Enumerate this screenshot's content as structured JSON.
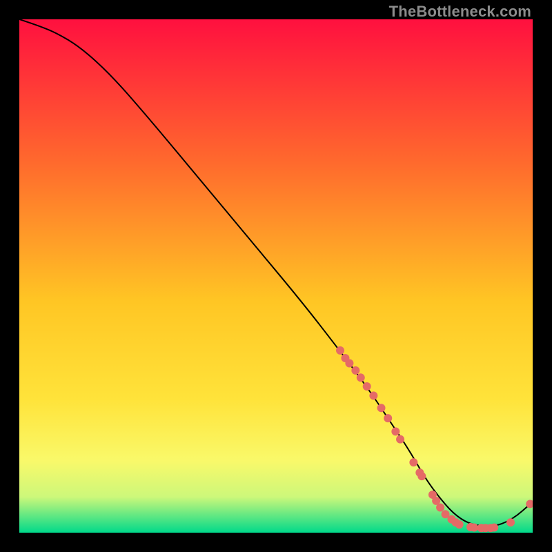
{
  "watermark": "TheBottleneck.com",
  "colors": {
    "gradient_top": "#ff103f",
    "gradient_mid1": "#ff6a2d",
    "gradient_mid2": "#ffc624",
    "gradient_mid3": "#ffe33a",
    "gradient_mid4": "#f9f96a",
    "gradient_mid5": "#cdf87a",
    "gradient_bottom": "#00d98a",
    "curve": "#000000",
    "marker": "#e56a66",
    "bg": "#000000"
  },
  "chart_data": {
    "type": "line",
    "title": "",
    "xlabel": "",
    "ylabel": "",
    "xlim": [
      0,
      100
    ],
    "ylim": [
      0,
      100
    ],
    "curve": {
      "x": [
        0,
        3,
        7,
        12,
        18,
        25,
        35,
        45,
        55,
        62,
        68,
        72,
        76,
        80,
        86,
        92,
        96,
        100
      ],
      "y": [
        100,
        99,
        97.5,
        94.5,
        89,
        81,
        69,
        57,
        45,
        36,
        28,
        22,
        16,
        9,
        2,
        1,
        2.5,
        6
      ]
    },
    "markers": [
      {
        "x": 62.5,
        "y": 35.5
      },
      {
        "x": 63.5,
        "y": 34
      },
      {
        "x": 64.3,
        "y": 33
      },
      {
        "x": 65.5,
        "y": 31.6
      },
      {
        "x": 66.5,
        "y": 30.2
      },
      {
        "x": 67.7,
        "y": 28.5
      },
      {
        "x": 69.0,
        "y": 26.7
      },
      {
        "x": 70.5,
        "y": 24.3
      },
      {
        "x": 71.8,
        "y": 22.3
      },
      {
        "x": 73.3,
        "y": 19.7
      },
      {
        "x": 74.2,
        "y": 18.2
      },
      {
        "x": 76.8,
        "y": 13.7
      },
      {
        "x": 78.0,
        "y": 11.7
      },
      {
        "x": 78.4,
        "y": 11.0
      },
      {
        "x": 80.5,
        "y": 7.4
      },
      {
        "x": 81.2,
        "y": 6.2
      },
      {
        "x": 82.0,
        "y": 4.9
      },
      {
        "x": 83.0,
        "y": 3.6
      },
      {
        "x": 84.2,
        "y": 2.6
      },
      {
        "x": 85.0,
        "y": 2.0
      },
      {
        "x": 85.7,
        "y": 1.6
      },
      {
        "x": 87.9,
        "y": 1.1
      },
      {
        "x": 88.6,
        "y": 1.0
      },
      {
        "x": 90.0,
        "y": 0.9
      },
      {
        "x": 90.8,
        "y": 0.9
      },
      {
        "x": 91.8,
        "y": 0.9
      },
      {
        "x": 92.5,
        "y": 1.0
      },
      {
        "x": 95.7,
        "y": 2.0
      },
      {
        "x": 99.5,
        "y": 5.6
      }
    ]
  }
}
